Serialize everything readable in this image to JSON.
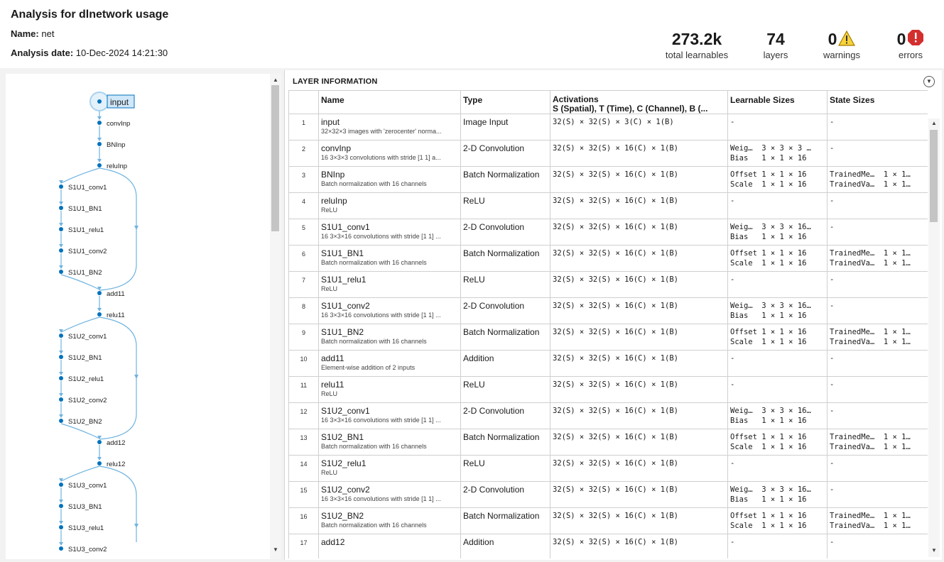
{
  "header": {
    "title": "Analysis for dlnetwork usage",
    "name_label": "Name:",
    "name_value": "net",
    "date_label": "Analysis date:",
    "date_value": "10-Dec-2024 14:21:30"
  },
  "stats": {
    "learnables": {
      "value": "273.2k",
      "label": "total learnables"
    },
    "layers": {
      "value": "74",
      "label": "layers"
    },
    "warnings": {
      "value": "0",
      "label": "warnings"
    },
    "errors": {
      "value": "0",
      "label": "errors"
    }
  },
  "colors": {
    "accent": "#0072bd",
    "edge": "#6fb3e0",
    "warning": "#f2c200",
    "error": "#d32f2f"
  },
  "graph": {
    "nodes": [
      "input",
      "convInp",
      "BNInp",
      "reluInp",
      "S1U1_conv1",
      "S1U1_BN1",
      "S1U1_relu1",
      "S1U1_conv2",
      "S1U1_BN2",
      "add11",
      "relu11",
      "S1U2_conv1",
      "S1U2_BN1",
      "S1U2_relu1",
      "S1U2_conv2",
      "S1U2_BN2",
      "add12",
      "relu12",
      "S1U3_conv1",
      "S1U3_BN1",
      "S1U3_relu1",
      "S1U3_conv2"
    ],
    "selected": "input"
  },
  "table": {
    "title": "LAYER INFORMATION",
    "headers": {
      "name": "Name",
      "type": "Type",
      "activations": "Activations",
      "activations_sub": "S (Spatial), T (Time), C (Channel), B (...",
      "learnables": "Learnable Sizes",
      "states": "State Sizes"
    },
    "rows": [
      {
        "idx": "1",
        "name": "input",
        "desc": "32×32×3 images with 'zerocenter' norma...",
        "type": "Image Input",
        "act": "32(S) × 32(S) × 3(C) × 1(B)",
        "learn": [
          "-"
        ],
        "state": [
          "-"
        ]
      },
      {
        "idx": "2",
        "name": "convInp",
        "desc": "16 3×3×3 convolutions with stride [1 1] a...",
        "type": "2-D Convolution",
        "act": "32(S) × 32(S) × 16(C) × 1(B)",
        "learn": [
          "Weig…  3 × 3 × 3 …",
          "Bias   1 × 1 × 16"
        ],
        "state": [
          "-"
        ]
      },
      {
        "idx": "3",
        "name": "BNInp",
        "desc": "Batch normalization with 16 channels",
        "type": "Batch Normalization",
        "act": "32(S) × 32(S) × 16(C) × 1(B)",
        "learn": [
          "Offset 1 × 1 × 16",
          "Scale  1 × 1 × 16"
        ],
        "state": [
          "TrainedMe…  1 × 1…",
          "TrainedVa…  1 × 1…"
        ]
      },
      {
        "idx": "4",
        "name": "reluInp",
        "desc": "ReLU",
        "type": "ReLU",
        "act": "32(S) × 32(S) × 16(C) × 1(B)",
        "learn": [
          "-"
        ],
        "state": [
          "-"
        ]
      },
      {
        "idx": "5",
        "name": "S1U1_conv1",
        "desc": "16 3×3×16 convolutions with stride [1 1] ...",
        "type": "2-D Convolution",
        "act": "32(S) × 32(S) × 16(C) × 1(B)",
        "learn": [
          "Weig…  3 × 3 × 16…",
          "Bias   1 × 1 × 16"
        ],
        "state": [
          "-"
        ]
      },
      {
        "idx": "6",
        "name": "S1U1_BN1",
        "desc": "Batch normalization with 16 channels",
        "type": "Batch Normalization",
        "act": "32(S) × 32(S) × 16(C) × 1(B)",
        "learn": [
          "Offset 1 × 1 × 16",
          "Scale  1 × 1 × 16"
        ],
        "state": [
          "TrainedMe…  1 × 1…",
          "TrainedVa…  1 × 1…"
        ]
      },
      {
        "idx": "7",
        "name": "S1U1_relu1",
        "desc": "ReLU",
        "type": "ReLU",
        "act": "32(S) × 32(S) × 16(C) × 1(B)",
        "learn": [
          "-"
        ],
        "state": [
          "-"
        ]
      },
      {
        "idx": "8",
        "name": "S1U1_conv2",
        "desc": "16 3×3×16 convolutions with stride [1 1] ...",
        "type": "2-D Convolution",
        "act": "32(S) × 32(S) × 16(C) × 1(B)",
        "learn": [
          "Weig…  3 × 3 × 16…",
          "Bias   1 × 1 × 16"
        ],
        "state": [
          "-"
        ]
      },
      {
        "idx": "9",
        "name": "S1U1_BN2",
        "desc": "Batch normalization with 16 channels",
        "type": "Batch Normalization",
        "act": "32(S) × 32(S) × 16(C) × 1(B)",
        "learn": [
          "Offset 1 × 1 × 16",
          "Scale  1 × 1 × 16"
        ],
        "state": [
          "TrainedMe…  1 × 1…",
          "TrainedVa…  1 × 1…"
        ]
      },
      {
        "idx": "10",
        "name": "add11",
        "desc": "Element-wise addition of 2 inputs",
        "type": "Addition",
        "act": "32(S) × 32(S) × 16(C) × 1(B)",
        "learn": [
          "-"
        ],
        "state": [
          "-"
        ]
      },
      {
        "idx": "11",
        "name": "relu11",
        "desc": "ReLU",
        "type": "ReLU",
        "act": "32(S) × 32(S) × 16(C) × 1(B)",
        "learn": [
          "-"
        ],
        "state": [
          "-"
        ]
      },
      {
        "idx": "12",
        "name": "S1U2_conv1",
        "desc": "16 3×3×16 convolutions with stride [1 1] ...",
        "type": "2-D Convolution",
        "act": "32(S) × 32(S) × 16(C) × 1(B)",
        "learn": [
          "Weig…  3 × 3 × 16…",
          "Bias   1 × 1 × 16"
        ],
        "state": [
          "-"
        ]
      },
      {
        "idx": "13",
        "name": "S1U2_BN1",
        "desc": "Batch normalization with 16 channels",
        "type": "Batch Normalization",
        "act": "32(S) × 32(S) × 16(C) × 1(B)",
        "learn": [
          "Offset 1 × 1 × 16",
          "Scale  1 × 1 × 16"
        ],
        "state": [
          "TrainedMe…  1 × 1…",
          "TrainedVa…  1 × 1…"
        ]
      },
      {
        "idx": "14",
        "name": "S1U2_relu1",
        "desc": "ReLU",
        "type": "ReLU",
        "act": "32(S) × 32(S) × 16(C) × 1(B)",
        "learn": [
          "-"
        ],
        "state": [
          "-"
        ]
      },
      {
        "idx": "15",
        "name": "S1U2_conv2",
        "desc": "16 3×3×16 convolutions with stride [1 1] ...",
        "type": "2-D Convolution",
        "act": "32(S) × 32(S) × 16(C) × 1(B)",
        "learn": [
          "Weig…  3 × 3 × 16…",
          "Bias   1 × 1 × 16"
        ],
        "state": [
          "-"
        ]
      },
      {
        "idx": "16",
        "name": "S1U2_BN2",
        "desc": "Batch normalization with 16 channels",
        "type": "Batch Normalization",
        "act": "32(S) × 32(S) × 16(C) × 1(B)",
        "learn": [
          "Offset 1 × 1 × 16",
          "Scale  1 × 1 × 16"
        ],
        "state": [
          "TrainedMe…  1 × 1…",
          "TrainedVa…  1 × 1…"
        ]
      },
      {
        "idx": "17",
        "name": "add12",
        "desc": "",
        "type": "Addition",
        "act": "32(S) × 32(S) × 16(C) × 1(B)",
        "learn": [
          "-"
        ],
        "state": [
          "-"
        ]
      }
    ]
  }
}
